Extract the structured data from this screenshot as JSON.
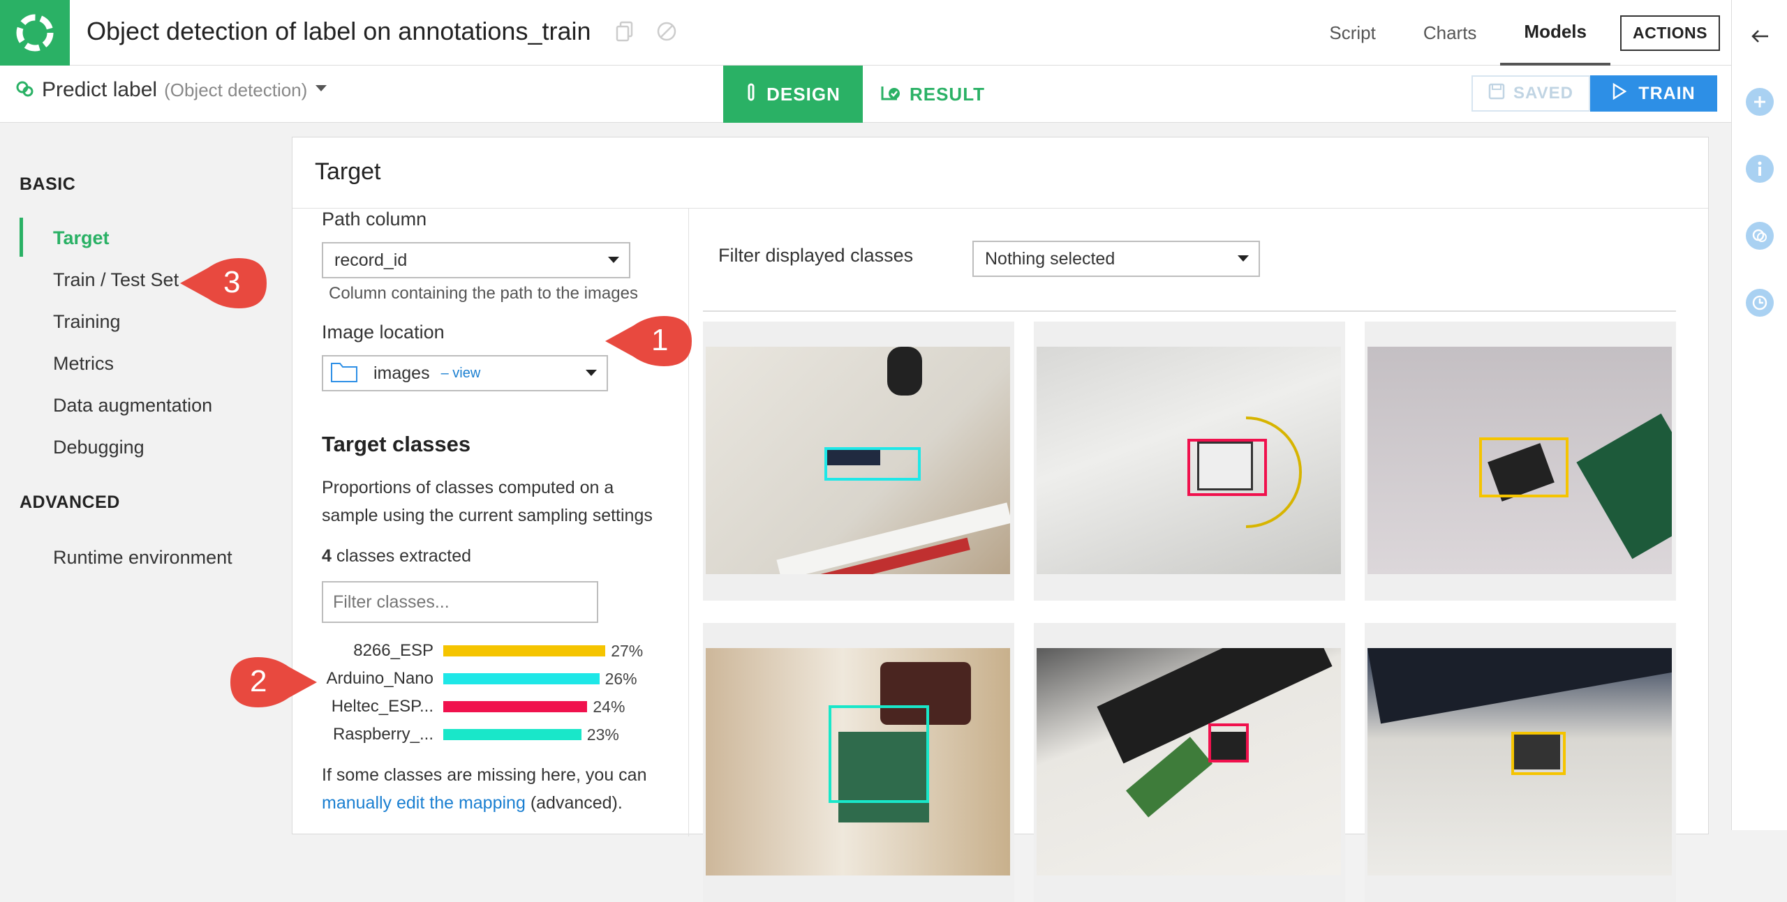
{
  "header": {
    "title": "Object detection of label on annotations_train",
    "nav": [
      "Script",
      "Charts",
      "Models"
    ],
    "actions_label": "ACTIONS"
  },
  "subheader": {
    "predict_label": "Predict label",
    "predict_type": "(Object detection)",
    "design_label": "DESIGN",
    "result_label": "RESULT",
    "saved_label": "SAVED",
    "train_label": "TRAIN"
  },
  "sidebar": {
    "basic_label": "BASIC",
    "advanced_label": "ADVANCED",
    "items": [
      "Target",
      "Train / Test Set",
      "Training",
      "Metrics",
      "Data augmentation",
      "Debugging"
    ],
    "advanced_items": [
      "Runtime environment"
    ]
  },
  "panel": {
    "title": "Target",
    "path_column_label": "Path column",
    "path_column_value": "record_id",
    "path_column_help": "Column containing the path to the images",
    "image_location_label": "Image location",
    "image_location_value": "images",
    "image_location_link": "– view",
    "target_classes_title": "Target classes",
    "target_classes_desc": "Proportions of classes computed on a sample using the current sampling settings",
    "classes_count": "4",
    "classes_extracted_label": "classes extracted",
    "filter_placeholder": "Filter classes...",
    "classes": [
      {
        "name": "8266_ESP",
        "pct": "27%",
        "value": 27,
        "color": "#f5c400"
      },
      {
        "name": "Arduino_Nano",
        "pct": "26%",
        "value": 26,
        "color": "#1ee7e7"
      },
      {
        "name": "Heltec_ESP...",
        "pct": "24%",
        "value": 24,
        "color": "#f0114d"
      },
      {
        "name": "Raspberry_...",
        "pct": "23%",
        "value": 23,
        "color": "#19e7c9"
      }
    ],
    "missing_text_pre": "If some classes are missing here, you can",
    "missing_link": "manually edit the mapping",
    "missing_text_post": "(advanced).",
    "filter_displayed_label": "Filter displayed classes",
    "filter_displayed_value": "Nothing selected"
  },
  "callouts": [
    "1",
    "2",
    "3"
  ],
  "colors": {
    "accent_green": "#2ab165",
    "train_blue": "#2d8fe6",
    "callout_red": "#e8493f"
  }
}
